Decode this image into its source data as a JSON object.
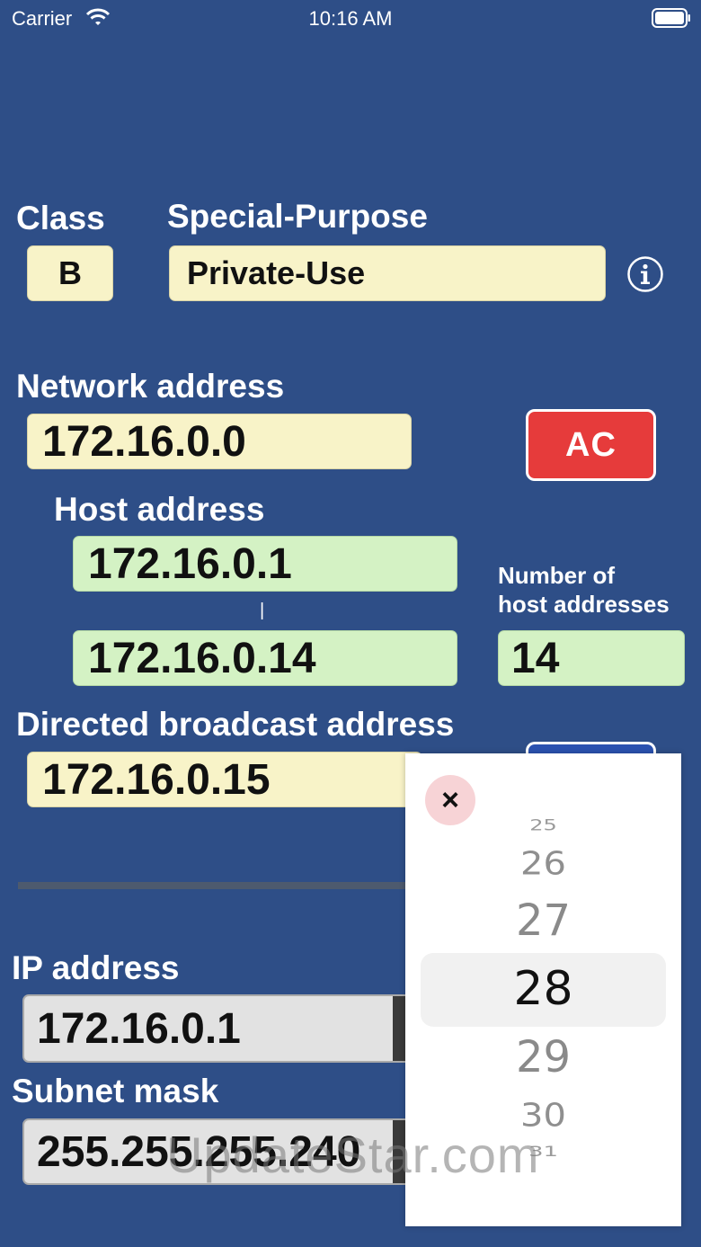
{
  "status_bar": {
    "carrier": "Carrier",
    "time": "10:16 AM"
  },
  "class": {
    "label": "Class",
    "value": "B"
  },
  "special_purpose": {
    "label": "Special-Purpose",
    "value": "Private-Use"
  },
  "network": {
    "label": "Network address",
    "value": "172.16.0.0"
  },
  "ac_button": {
    "label": "AC"
  },
  "host": {
    "label": "Host address",
    "first": "172.16.0.1",
    "separator": "|",
    "last": "172.16.0.14"
  },
  "host_count": {
    "label_line1": "Number of",
    "label_line2": "host addresses",
    "value": "14"
  },
  "broadcast": {
    "label": "Directed broadcast address",
    "value": "172.16.0.15"
  },
  "ip": {
    "label": "IP address",
    "value": "172.16.0.1"
  },
  "subnet": {
    "label": "Subnet mask",
    "value": "255.255.255.240"
  },
  "prefix_picker": {
    "close_label": "×",
    "items": [
      "25",
      "26",
      "27",
      "28",
      "29",
      "30",
      "31"
    ],
    "selected": "28"
  },
  "watermark": "UpdateStar.com",
  "colors": {
    "background": "#2e4e87",
    "yellow_field": "#f8f3c8",
    "green_field": "#d4f2c4",
    "grey_field": "#e2e2e2",
    "ac_button": "#e63b3b"
  }
}
